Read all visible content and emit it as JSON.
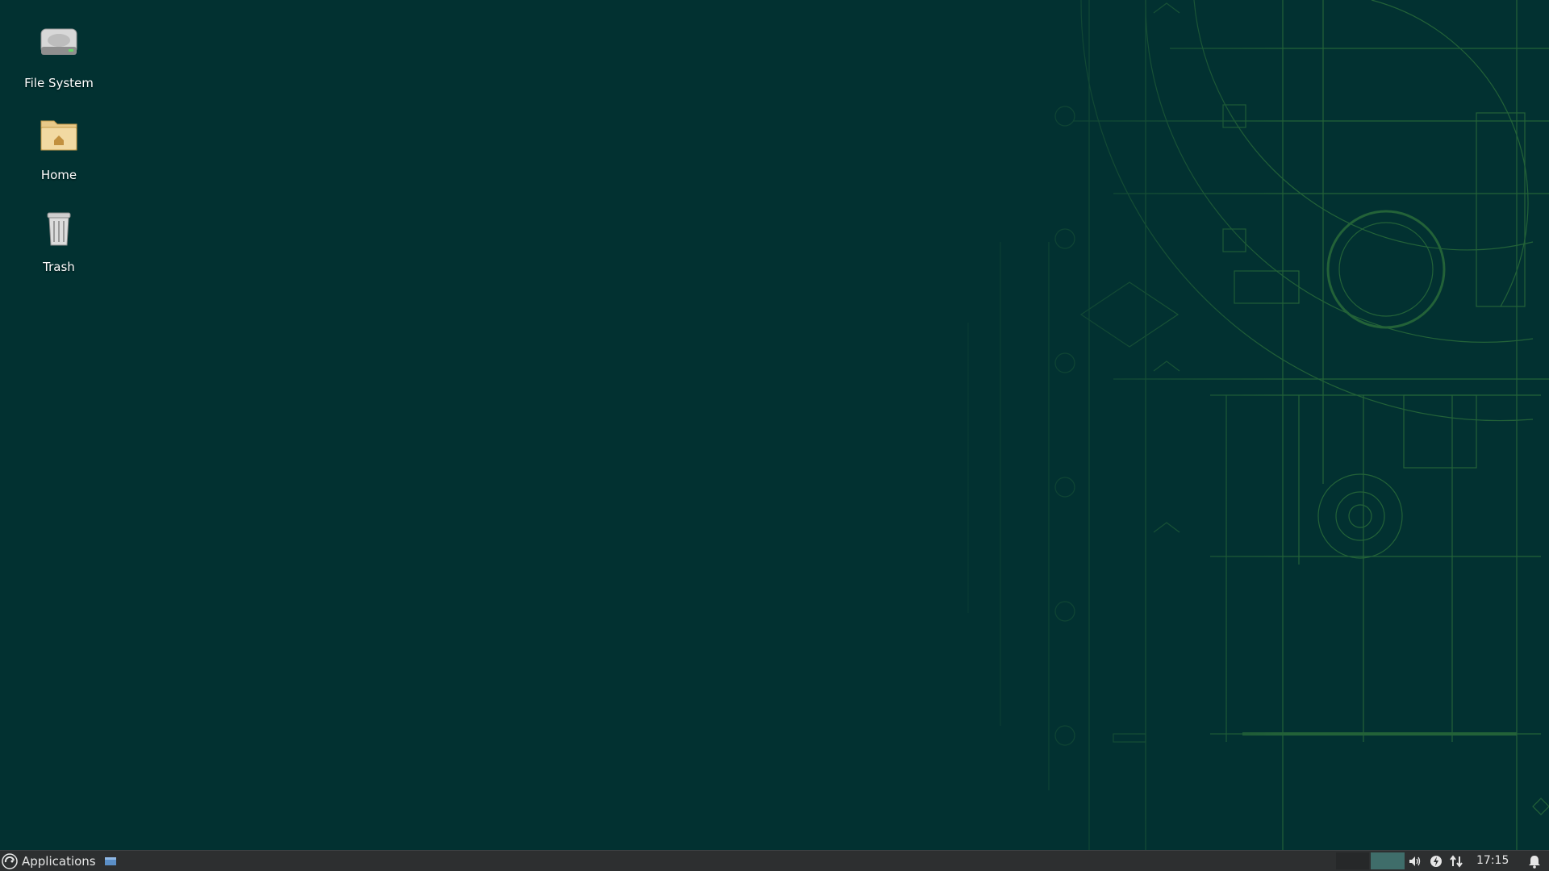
{
  "desktop": {
    "background_color": "#023131",
    "wallpaper_accent": "#3e8a3e",
    "icons": [
      {
        "label": "File System",
        "icon": "drive-icon"
      },
      {
        "label": "Home",
        "icon": "home-folder-icon"
      },
      {
        "label": "Trash",
        "icon": "trash-icon"
      }
    ]
  },
  "taskbar": {
    "applications_label": "Applications",
    "workspaces": [
      {
        "name": "workspace-1",
        "active": false
      },
      {
        "name": "workspace-2",
        "active": true
      }
    ],
    "tray_icons": [
      "volume-icon",
      "power-icon",
      "network-icon"
    ],
    "clock": "17:15",
    "notification_icon": "bell-icon"
  }
}
